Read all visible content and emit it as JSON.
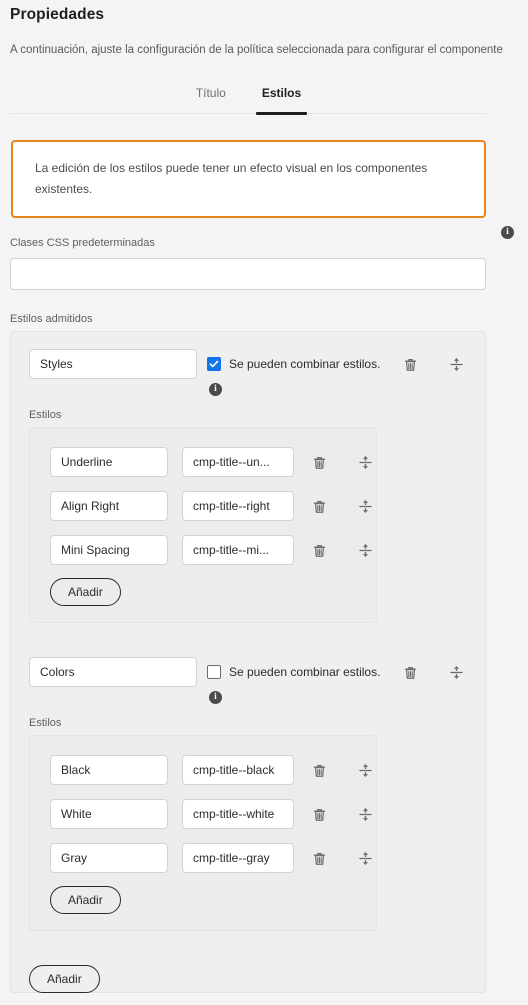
{
  "header": {
    "title": "Propiedades",
    "subtitle": "A continuación, ajuste la configuración de la política seleccionada para configurar el componente"
  },
  "tabs": [
    {
      "label": "Título",
      "active": false
    },
    {
      "label": "Estilos",
      "active": true
    }
  ],
  "warning": {
    "text": "La edición de los estilos puede tener un efecto visual en los componentes existentes.",
    "border_color": "#e68619"
  },
  "css_classes_field": {
    "label": "Clases CSS predeterminadas",
    "value": "",
    "placeholder": "",
    "info_icon": "info-icon"
  },
  "supported_styles": {
    "label": "Estilos admitidos",
    "add_button_label": "Añadir",
    "groups": [
      {
        "name": "Styles",
        "combinable_label": "Se pueden combinar estilos.",
        "combinable_checked": true,
        "styles_label": "Estilos",
        "add_button_label": "Añadir",
        "delete_icon": "trash-icon",
        "reorder_icon": "drag-handle-icon",
        "info_icon": "info-icon",
        "styles": [
          {
            "name": "Underline",
            "css_class": "cmp-title--un..."
          },
          {
            "name": "Align Right",
            "css_class": "cmp-title--right"
          },
          {
            "name": "Mini Spacing",
            "css_class": "cmp-title--mi..."
          }
        ]
      },
      {
        "name": "Colors",
        "combinable_label": "Se pueden combinar estilos.",
        "combinable_checked": false,
        "styles_label": "Estilos",
        "add_button_label": "Añadir",
        "delete_icon": "trash-icon",
        "reorder_icon": "drag-handle-icon",
        "info_icon": "info-icon",
        "styles": [
          {
            "name": "Black",
            "css_class": "cmp-title--black"
          },
          {
            "name": "White",
            "css_class": "cmp-title--white"
          },
          {
            "name": "Gray",
            "css_class": "cmp-title--gray"
          }
        ]
      }
    ]
  },
  "colors": {
    "accent_blue": "#1473e6",
    "warning_orange": "#e68619",
    "page_bg": "#f4f4f4",
    "panel_bg": "#efefef",
    "inner_panel_bg": "#ececec"
  }
}
